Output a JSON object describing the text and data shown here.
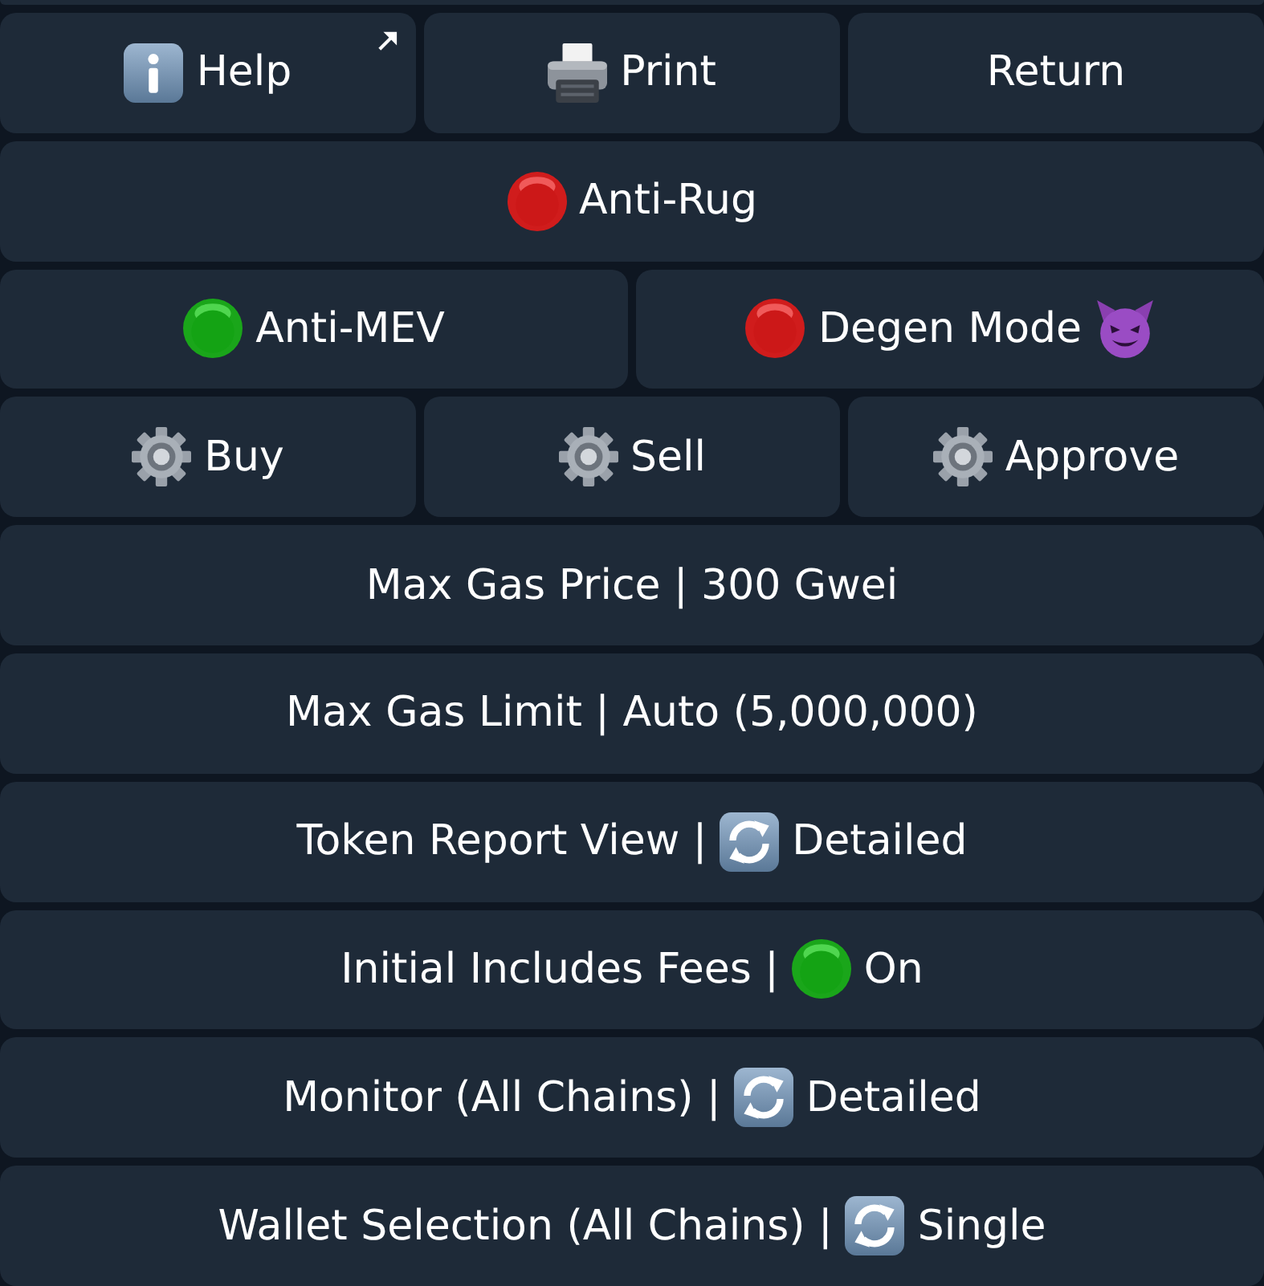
{
  "keyboard": {
    "rows": [
      [
        {
          "kind": "help",
          "label": "Help"
        },
        {
          "kind": "print",
          "label": "Print"
        },
        {
          "kind": "plain",
          "label": "Return"
        }
      ],
      [
        {
          "kind": "toggle",
          "on": false,
          "label": "Anti-Rug"
        }
      ],
      [
        {
          "kind": "toggle",
          "on": true,
          "label": "Anti-MEV"
        },
        {
          "kind": "degen",
          "on": false,
          "label": "Degen Mode"
        }
      ],
      [
        {
          "kind": "settings",
          "label": "Buy"
        },
        {
          "kind": "settings",
          "label": "Sell"
        },
        {
          "kind": "settings",
          "label": "Approve"
        }
      ],
      [
        {
          "kind": "plain",
          "label": "Max Gas Price | 300 Gwei"
        }
      ],
      [
        {
          "kind": "plain",
          "label": "Max Gas Limit | Auto (5,000,000)"
        }
      ],
      [
        {
          "kind": "cycle",
          "label": "Token Report View |",
          "value": "Detailed"
        }
      ],
      [
        {
          "kind": "switch",
          "label": "Initial Includes Fees |",
          "on": true,
          "value": "On"
        }
      ],
      [
        {
          "kind": "cycle",
          "label": "Monitor (All Chains) |",
          "value": "Detailed"
        }
      ],
      [
        {
          "kind": "cycle",
          "label": "Wallet Selection (All Chains) |",
          "value": "Single"
        }
      ]
    ]
  }
}
